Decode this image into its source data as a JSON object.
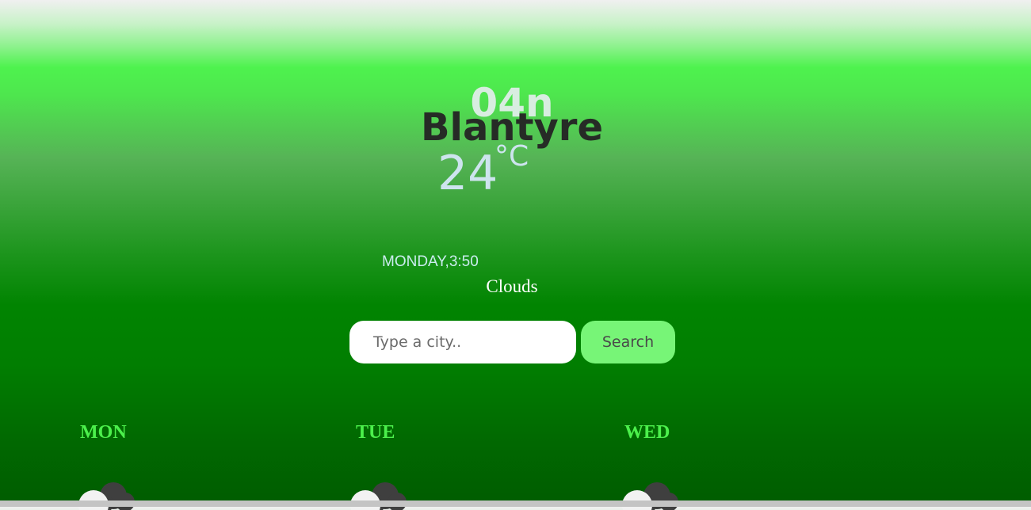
{
  "weather": {
    "icon_code": "04n",
    "city": "Blantyre",
    "temperature": "24",
    "unit": "°C",
    "datetime": "MONDAY,3:50",
    "description": "Clouds"
  },
  "search": {
    "placeholder": "Type a city..",
    "value": "",
    "button_label": "Search"
  },
  "forecast": [
    {
      "day": "MON",
      "icon": "clouds-icon"
    },
    {
      "day": "TUE",
      "icon": "clouds-icon"
    },
    {
      "day": "WED",
      "icon": "clouds-icon"
    }
  ],
  "colors": {
    "city": "#262b26",
    "day_label": "#4cf04c",
    "search_button": "#77f577"
  }
}
